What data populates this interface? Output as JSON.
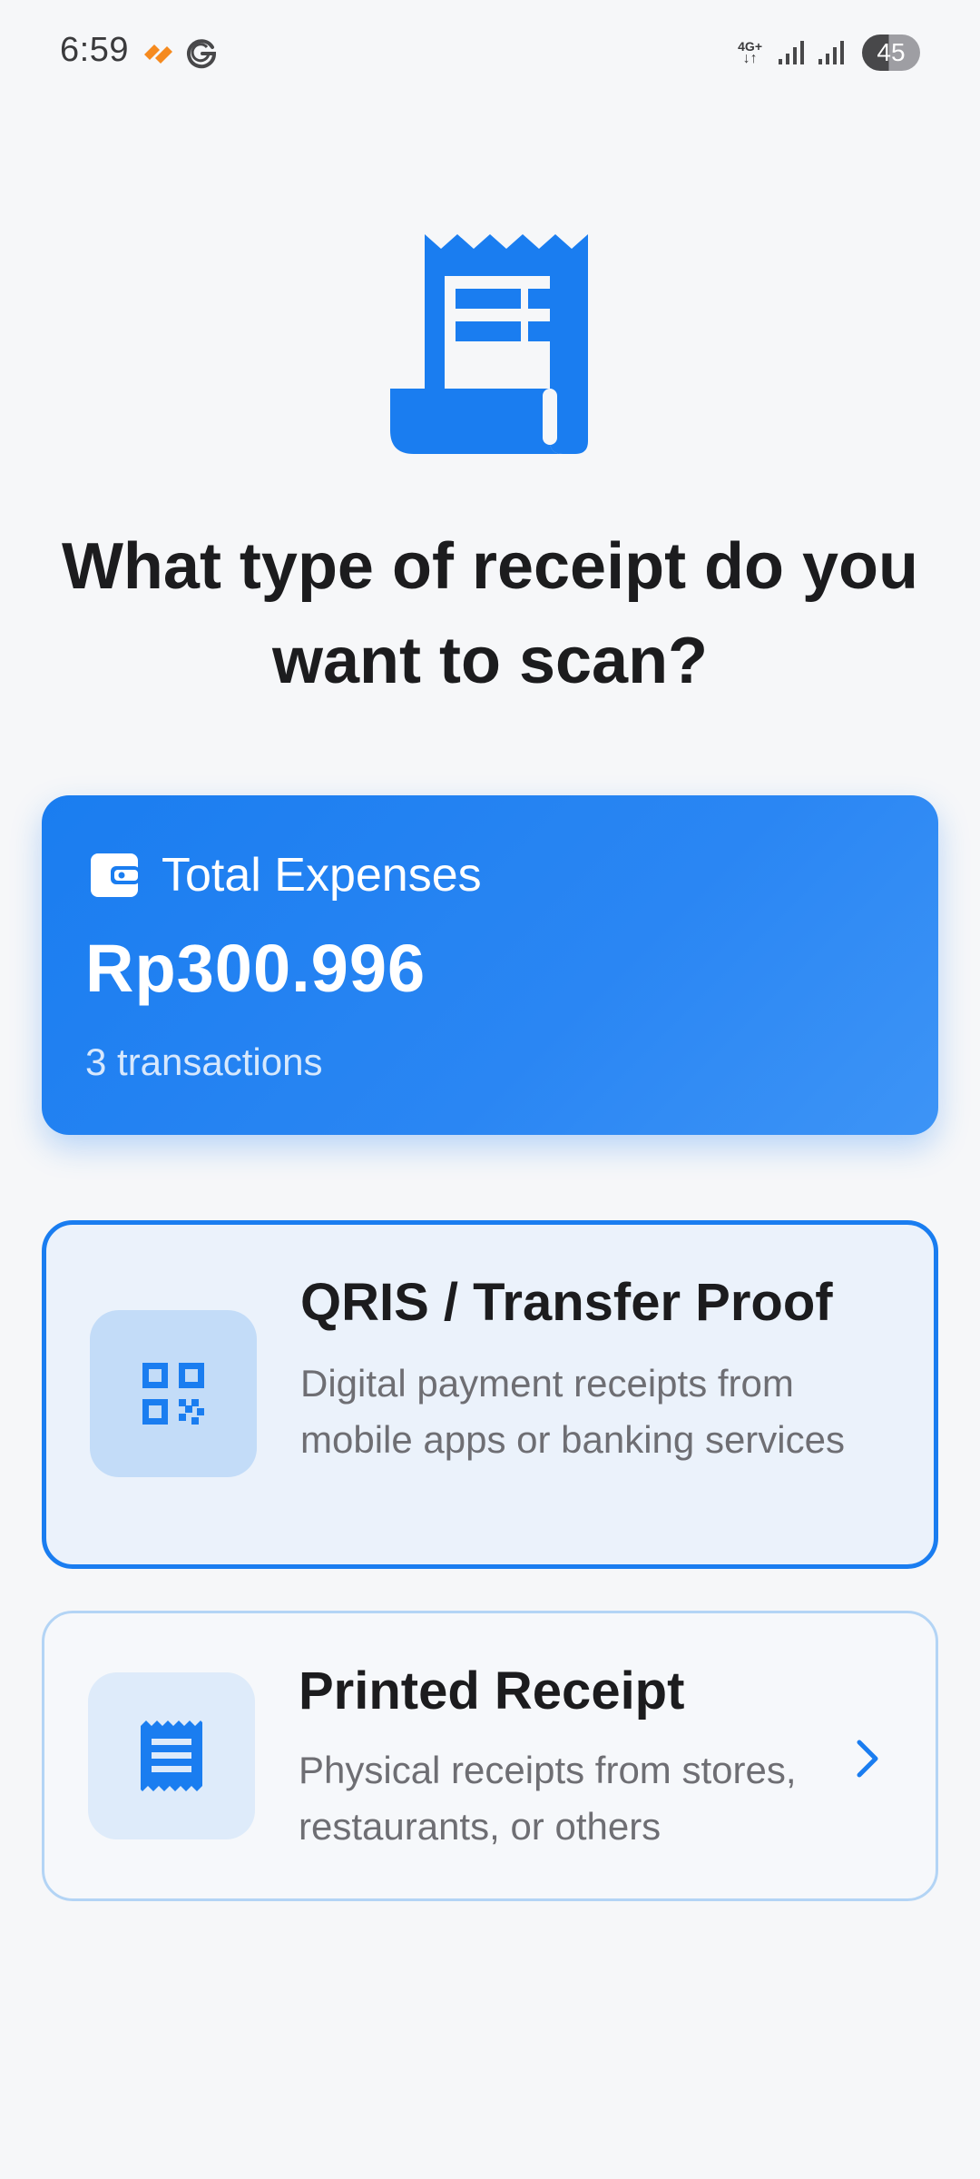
{
  "status_bar": {
    "time": "6:59",
    "network_label": "4G+",
    "battery_level": "45",
    "icons": [
      "app-notification-icon",
      "google-icon",
      "signal-icon",
      "signal-icon-2"
    ]
  },
  "hero": {
    "icon": "receipt-icon",
    "title": "What type of receipt do you want to scan?"
  },
  "summary": {
    "icon": "wallet-icon",
    "label": "Total Expenses",
    "amount": "Rp300.996",
    "count": "3 transactions"
  },
  "options": [
    {
      "icon": "qr-code-icon",
      "title": "QRIS / Transfer Proof",
      "description": "Digital payment receipts from mobile apps or banking services",
      "selected": true
    },
    {
      "icon": "printed-receipt-icon",
      "title": "Printed Receipt",
      "description": "Physical receipts from stores, restaurants, or others",
      "selected": false,
      "trailing_icon": "chevron-right-icon"
    }
  ],
  "colors": {
    "accent": "#1a7df0",
    "background": "#f6f7f9",
    "title_text": "#1c1c1e",
    "secondary_text": "#6e6e73",
    "selected_card_bg": "#ebf2fb",
    "icon_box_selected": "#c3dcf8",
    "icon_box_normal": "#deebfa"
  }
}
